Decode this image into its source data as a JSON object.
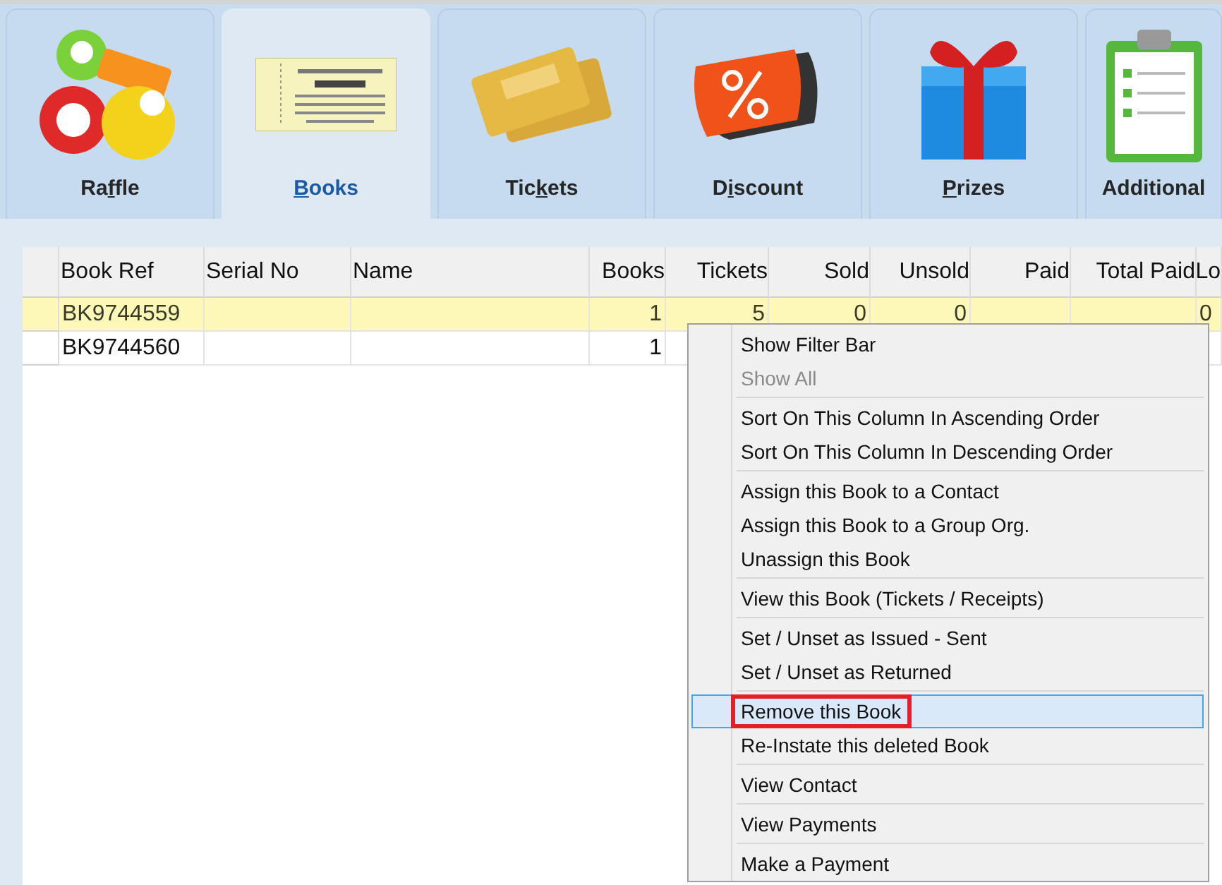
{
  "tabs": [
    {
      "label": "Raffle",
      "selected": false
    },
    {
      "label": "Books",
      "selected": true
    },
    {
      "label": "Tickets",
      "selected": false
    },
    {
      "label": "Discount",
      "selected": false
    },
    {
      "label": "Prizes",
      "selected": false
    },
    {
      "label": "Additional",
      "selected": false
    }
  ],
  "table": {
    "columns": [
      "Book Ref",
      "Serial No",
      "Name",
      "Books",
      "Tickets",
      "Sold",
      "Unsold",
      "Paid",
      "Total Paid",
      "Lo"
    ],
    "rows": [
      {
        "selected": true,
        "cells": [
          "BK9744559",
          null,
          null,
          "1",
          "5",
          "0",
          "0",
          null,
          null,
          "0"
        ]
      },
      {
        "selected": false,
        "cells": [
          "BK9744560",
          null,
          null,
          "1",
          null,
          null,
          null,
          null,
          null,
          null
        ]
      }
    ]
  },
  "context_menu": {
    "groups": [
      [
        {
          "label": "Show Filter Bar",
          "disabled": false,
          "selected": false,
          "annotated": false
        },
        {
          "label": "Show All",
          "disabled": true,
          "selected": false,
          "annotated": false
        }
      ],
      [
        {
          "label": "Sort On This Column In Ascending Order",
          "disabled": false,
          "selected": false,
          "annotated": false
        },
        {
          "label": "Sort On This Column In Descending Order",
          "disabled": false,
          "selected": false,
          "annotated": false
        }
      ],
      [
        {
          "label": "Assign this Book to a Contact",
          "disabled": false,
          "selected": false,
          "annotated": false
        },
        {
          "label": "Assign this Book to a Group Org.",
          "disabled": false,
          "selected": false,
          "annotated": false
        },
        {
          "label": "Unassign this Book",
          "disabled": false,
          "selected": false,
          "annotated": false
        }
      ],
      [
        {
          "label": "View this Book (Tickets / Receipts)",
          "disabled": false,
          "selected": false,
          "annotated": false
        }
      ],
      [
        {
          "label": "Set / Unset as Issued - Sent",
          "disabled": false,
          "selected": false,
          "annotated": false
        },
        {
          "label": "Set / Unset as Returned",
          "disabled": false,
          "selected": false,
          "annotated": false
        }
      ],
      [
        {
          "label": "Remove this Book",
          "disabled": false,
          "selected": true,
          "annotated": true
        },
        {
          "label": "Re-Instate this deleted Book",
          "disabled": false,
          "selected": false,
          "annotated": false
        }
      ],
      [
        {
          "label": "View Contact",
          "disabled": false,
          "selected": false,
          "annotated": false
        }
      ],
      [
        {
          "label": "View Payments",
          "disabled": false,
          "selected": false,
          "annotated": false
        }
      ],
      [
        {
          "label": "Make a Payment",
          "disabled": false,
          "selected": false,
          "annotated": false
        }
      ]
    ]
  }
}
